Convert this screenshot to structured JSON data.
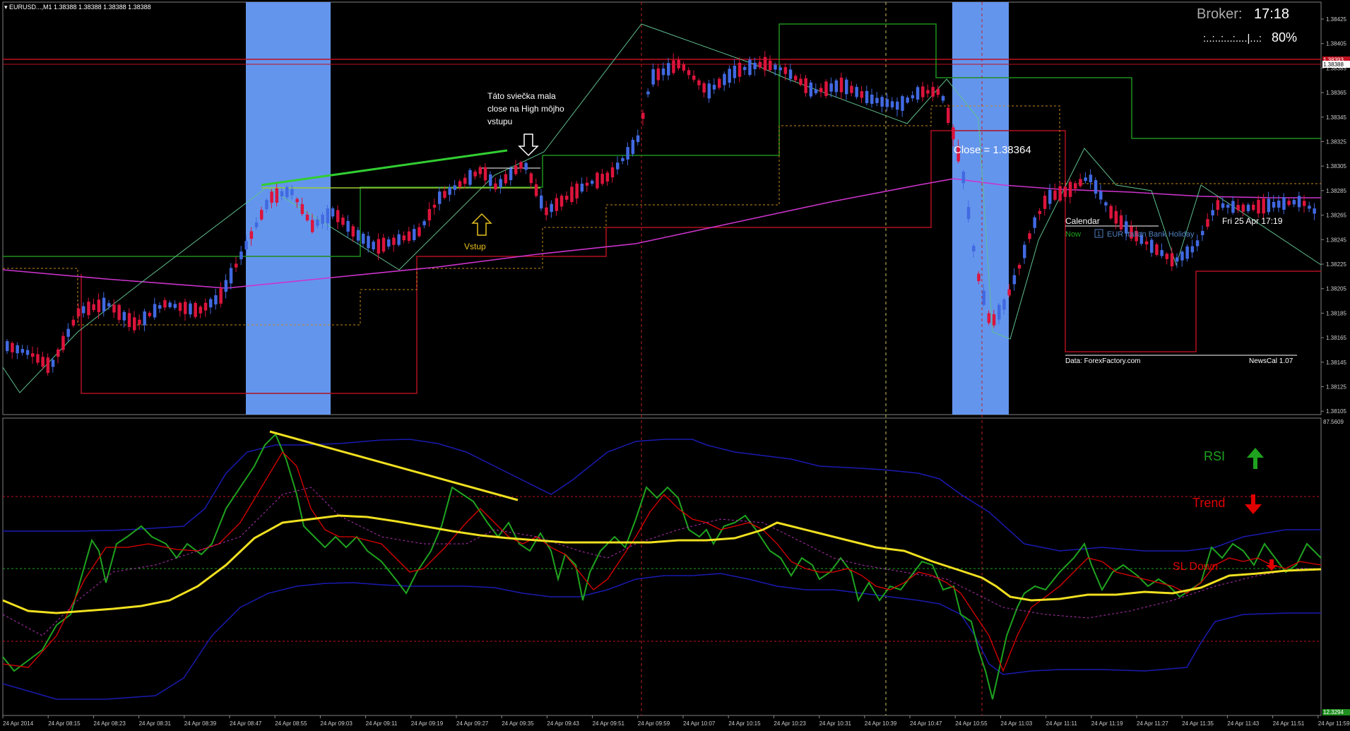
{
  "header": {
    "symbol_label": "▾ EURUSD...,M1  1.38388 1.38388 1.38388 1.38388"
  },
  "broker": {
    "label": "Broker:",
    "time": "17:18",
    "progress_text": ":..:..:...:....|...:",
    "progress_percent": "80%"
  },
  "annotations": {
    "note_line1": "Táto sviečka mala",
    "note_line2": "close na High môjho",
    "note_line3": "vstupu",
    "entry_label": "Vstup",
    "close_label": "Close = 1.38364"
  },
  "calendar": {
    "title": "Calendar",
    "date": "Fri 25 Apr 17:19",
    "now_label": "Now",
    "event_badge": "1",
    "event_text": "EUR Italian Bank Holiday",
    "source": "Data: ForexFactory.com",
    "version": "NewsCal 1.07"
  },
  "indicator_labels": {
    "rsi": "RSI",
    "trend": "Trend",
    "sl": "SL Down"
  },
  "price_axis": {
    "ticks": [
      "1.38425",
      "1.38405",
      "1.38385",
      "1.38365",
      "1.38345",
      "1.38325",
      "1.38305",
      "1.38285",
      "1.38265",
      "1.38245",
      "1.38225",
      "1.38205",
      "1.38185",
      "1.38165",
      "1.38145",
      "1.38125",
      "1.38105"
    ],
    "current_price": "1.38388",
    "red_line_price": "1.38393"
  },
  "indicator_axis": {
    "top": "87.5609",
    "bottom": "12.3294"
  },
  "time_axis": {
    "ticks": [
      "24 Apr 2014",
      "24 Apr 08:15",
      "24 Apr 08:23",
      "24 Apr 08:31",
      "24 Apr 08:39",
      "24 Apr 08:47",
      "24 Apr 08:55",
      "24 Apr 09:03",
      "24 Apr 09:11",
      "24 Apr 09:19",
      "24 Apr 09:27",
      "24 Apr 09:35",
      "24 Apr 09:43",
      "24 Apr 09:51",
      "24 Apr 09:59",
      "24 Apr 10:07",
      "24 Apr 10:15",
      "24 Apr 10:23",
      "24 Apr 10:31",
      "24 Apr 10:39",
      "24 Apr 10:47",
      "24 Apr 10:55",
      "24 Apr 11:03",
      "24 Apr 11:11",
      "24 Apr 11:19",
      "24 Apr 11:27",
      "24 Apr 11:35",
      "24 Apr 11:43",
      "24 Apr 11:51",
      "24 Apr 11:59"
    ]
  },
  "colors": {
    "background": "#000000",
    "bull_candle": "#4169e1",
    "bear_candle": "#dc143c",
    "session_band": "#6495ed",
    "ma_magenta": "#cc33cc",
    "channel_green": "#1f8f1f",
    "channel_red": "#b01020",
    "channel_orange": "#c98a1a",
    "zigzag": "#5fbf8f",
    "rsi_green": "#1fa31f",
    "signal_red": "#e00000",
    "band_blue": "#1a1ab0",
    "yellow_ma": "#f0e020"
  },
  "icons": {
    "rsi_arrow": "arrow-up-icon",
    "trend_arrow": "arrow-down-icon",
    "sl_arrow": "arrow-down-small-icon",
    "note_arrow": "arrow-down-outline-icon",
    "entry_arrow": "arrow-up-outline-icon"
  }
}
